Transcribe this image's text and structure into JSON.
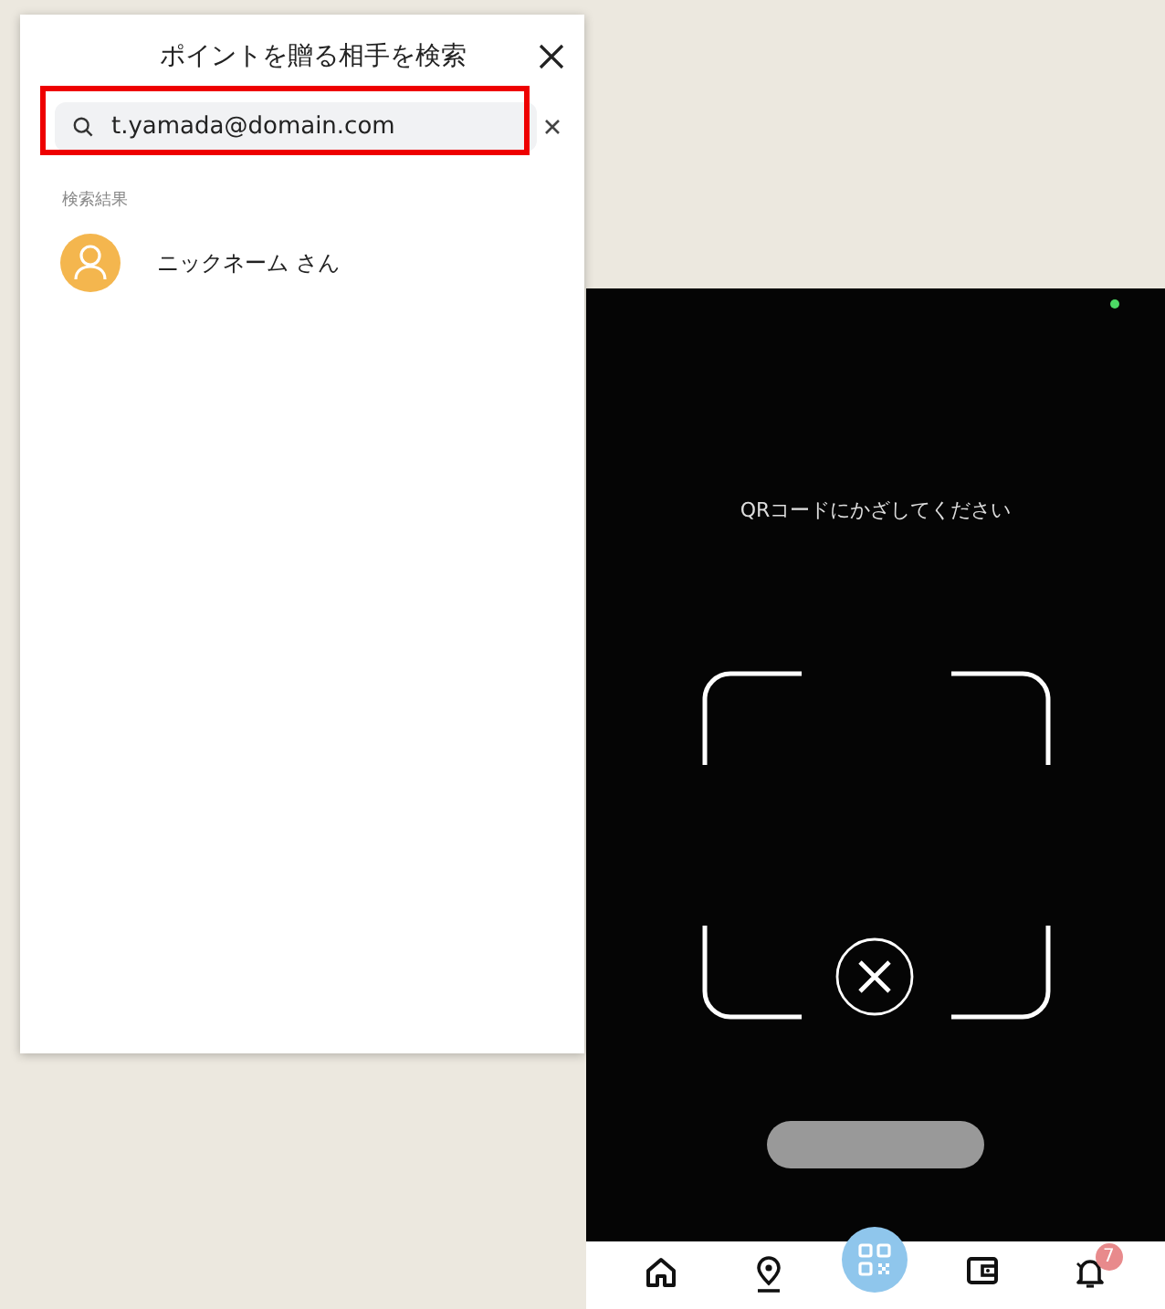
{
  "search_panel": {
    "title": "ポイントを贈る相手を検索",
    "search": {
      "value": "t.yamada@domain.com",
      "highlighted": true
    },
    "results_heading": "検索結果",
    "results": [
      {
        "name": "ニックネーム さん"
      }
    ]
  },
  "scanner": {
    "instruction": "QRコードにかざしてください",
    "nav_items": [
      {
        "kind": "home"
      },
      {
        "kind": "pin"
      },
      {
        "kind": "qr"
      },
      {
        "kind": "wallet"
      },
      {
        "kind": "bell",
        "badge": "7"
      }
    ]
  }
}
